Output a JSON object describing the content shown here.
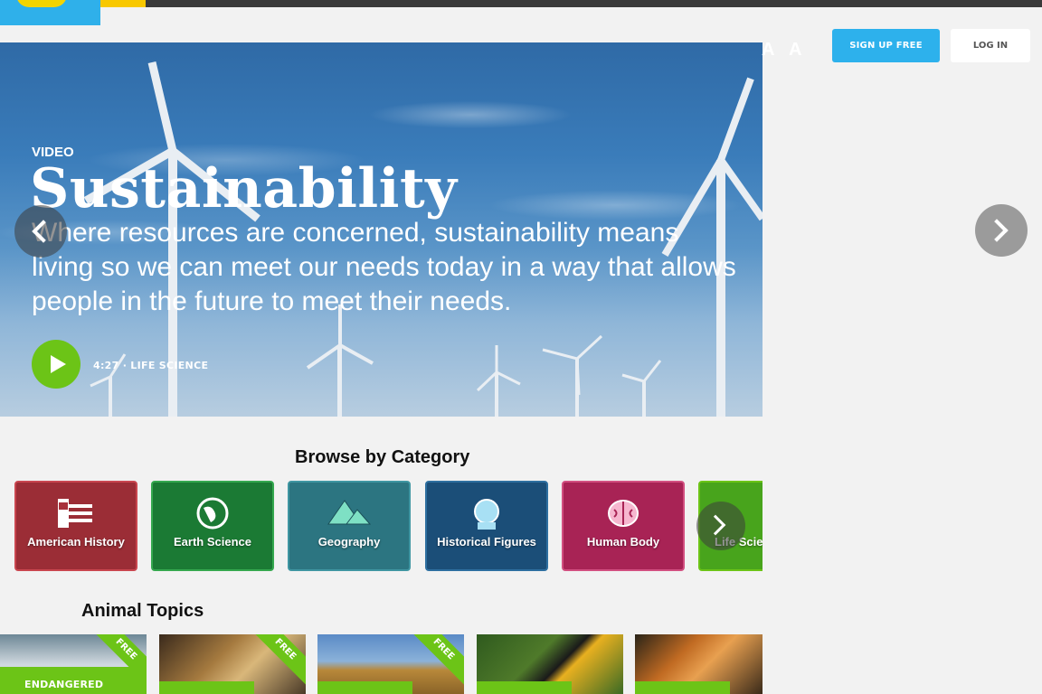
{
  "header": {
    "logo_icon": "brand-logo",
    "text_size_small": "A",
    "text_size_large": "A",
    "signup_label": "SIGN UP FREE",
    "login_label": "LOG IN",
    "accent_blue": "#2db1ec",
    "accent_green": "#6cc417"
  },
  "hero": {
    "kicker": "VIDEO",
    "title": "Sustainability",
    "description": "Where resources are concerned, sustainability means living so we can meet our needs today in a way that allows people in the future to meet their needs.",
    "meta": "4:27 · LIFE SCIENCE",
    "play_icon": "play-icon",
    "prev_icon": "chevron-left-icon",
    "next_icon": "chevron-right-icon"
  },
  "categories": {
    "title": "Browse by Category",
    "items": [
      {
        "label": "American History",
        "icon": "flag-icon",
        "color": "#a8323c"
      },
      {
        "label": "Earth Science",
        "icon": "globe-icon",
        "color": "#1f8a3a"
      },
      {
        "label": "Geography",
        "icon": "mountain-icon",
        "color": "#2f7c86"
      },
      {
        "label": "Historical Figures",
        "icon": "portrait-icon",
        "color": "#1d5a8c"
      },
      {
        "label": "Human Body",
        "icon": "brain-icon",
        "color": "#b0245c"
      },
      {
        "label": "Life Science",
        "icon": "leaf-icon",
        "color": "#4caa1f"
      }
    ],
    "next_icon": "chevron-right-icon"
  },
  "animals": {
    "title": "Animal Topics",
    "items": [
      {
        "badge": "FREE",
        "label": "ENDANGERED"
      },
      {
        "badge": "FREE",
        "label": ""
      },
      {
        "badge": "FREE",
        "label": ""
      },
      {
        "badge": "",
        "label": ""
      },
      {
        "badge": "",
        "label": ""
      }
    ]
  }
}
